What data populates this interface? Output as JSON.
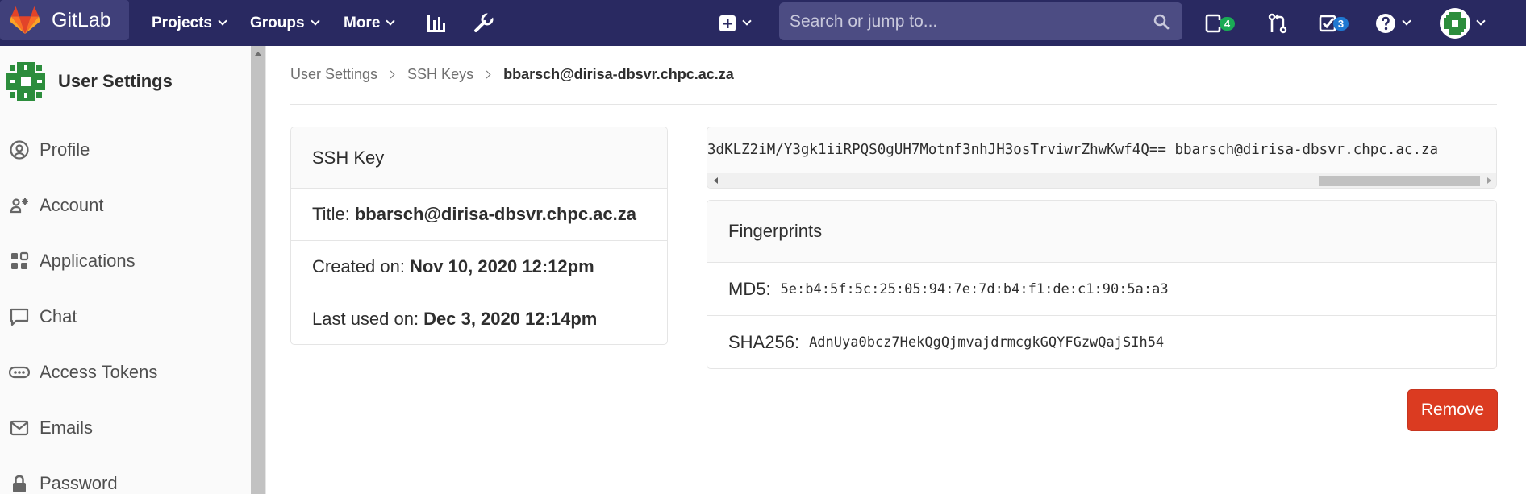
{
  "navbar": {
    "logo_text": "GitLab",
    "projects_label": "Projects",
    "groups_label": "Groups",
    "more_label": "More",
    "search_placeholder": "Search or jump to...",
    "issues_count": "4",
    "todos_count": "3",
    "bg_color": "#292961"
  },
  "sidebar": {
    "title": "User Settings",
    "items": [
      {
        "label": "Profile",
        "icon": "profile-icon"
      },
      {
        "label": "Account",
        "icon": "account-icon"
      },
      {
        "label": "Applications",
        "icon": "applications-icon"
      },
      {
        "label": "Chat",
        "icon": "chat-icon"
      },
      {
        "label": "Access Tokens",
        "icon": "access-tokens-icon"
      },
      {
        "label": "Emails",
        "icon": "emails-icon"
      },
      {
        "label": "Password",
        "icon": "password-icon"
      }
    ]
  },
  "breadcrumb": {
    "items": [
      "User Settings",
      "SSH Keys",
      "bbarsch@dirisa-dbsvr.chpc.ac.za"
    ]
  },
  "ssh_key_card": {
    "header": "SSH Key",
    "title_label": "Title:",
    "title_value": "bbarsch@dirisa-dbsvr.chpc.ac.za",
    "created_label": "Created on:",
    "created_value": "Nov 10, 2020 12:12pm",
    "last_used_label": "Last used on:",
    "last_used_value": "Dec 3, 2020 12:14pm"
  },
  "key_text": "3dKLZ2iM/Y3gk1iiRPQS0gUH7Motnf3nhJH3osTrviwrZhwKwf4Q== bbarsch@dirisa-dbsvr.chpc.ac.za",
  "fingerprints": {
    "header": "Fingerprints",
    "md5_label": "MD5:",
    "md5_value": "5e:b4:5f:5c:25:05:94:7e:7d:b4:f1:de:c1:90:5a:a3",
    "sha256_label": "SHA256:",
    "sha256_value": "AdnUya0bcz7HekQgQjmvajdrmcgkGQYFGzwQajSIh54"
  },
  "remove_label": "Remove",
  "colors": {
    "remove_button": "#db3b21",
    "issues_badge": "#1aaa55",
    "todos_badge": "#1f78d1"
  }
}
